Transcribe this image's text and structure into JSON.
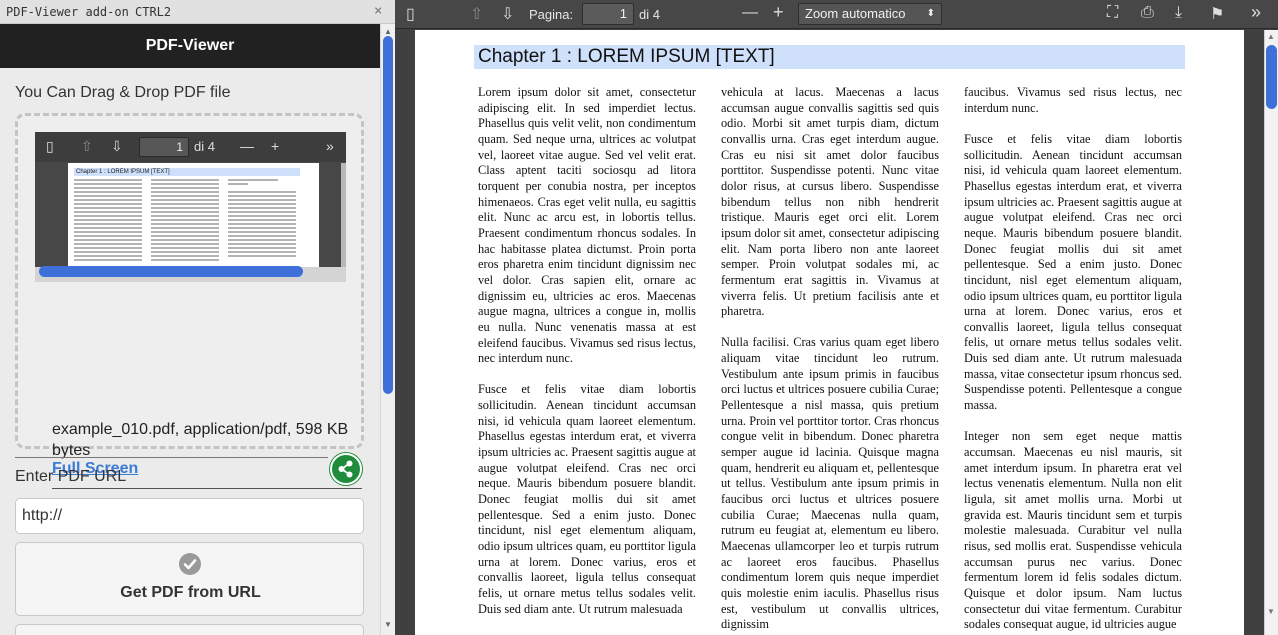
{
  "addon": {
    "window_title": "PDF-Viewer add-on",
    "shortcut": "CTRL2",
    "close_glyph": "×",
    "header": "PDF-Viewer",
    "drop_label": "You Can Drag & Drop PDF file",
    "file_info": "example_010.pdf, application/pdf, 598 KB bytes",
    "fullscreen_link": "Full Screen",
    "url_label": "Enter PDF URL",
    "url_value": "http://",
    "get_button": "Get PDF from URL",
    "share_icon": "share-icon",
    "mini_viewer": {
      "page_value": "1",
      "page_of": "di 4",
      "chapter": "Chapter 1 : LOREM IPSUM [TEXT]"
    }
  },
  "viewer": {
    "toolbar": {
      "sidebar_toggle": "▯",
      "prev": "⇧",
      "next": "⇩",
      "page_label": "Pagina:",
      "page_value": "1",
      "page_of": "di 4",
      "zoom_out": "—",
      "zoom_in": "+",
      "zoom_value": "Zoom automatico",
      "zoom_caret": "⬍",
      "fullscreen": "⛶",
      "print": "⎙",
      "download": "⤓",
      "bookmark": "⚑",
      "more": "»"
    },
    "chapter_title": "Chapter 1 : LOREM IPSUM [TEXT]",
    "columns": [
      [
        "Lorem ipsum dolor sit amet, consectetur adipiscing elit. In sed imperdiet lectus. Phasellus quis velit velit, non condimentum quam. Sed neque urna, ultrices ac volutpat vel, laoreet vitae augue. Sed vel velit erat. Class aptent taciti sociosqu ad litora torquent per conubia nostra, per inceptos himenaeos. Cras eget velit nulla, eu sagittis elit. Nunc ac arcu est, in lobortis tellus. Praesent condimentum rhoncus sodales. In hac habitasse platea dictumst. Proin porta eros pharetra enim tincidunt dignissim nec vel dolor. Cras sapien elit, ornare ac dignissim eu, ultricies ac eros. Maecenas augue magna, ultrices a congue in, mollis eu nulla. Nunc venenatis massa at est eleifend faucibus. Vivamus sed risus lectus, nec interdum nunc.",
        "Fusce et felis vitae diam lobortis sollicitudin. Aenean tincidunt accumsan nisi, id vehicula quam laoreet elementum. Phasellus egestas interdum erat, et viverra ipsum ultricies ac. Praesent sagittis augue at augue volutpat eleifend. Cras nec orci neque. Mauris bibendum posuere blandit. Donec feugiat mollis dui sit amet pellentesque. Sed a enim justo. Donec tincidunt, nisl eget elementum aliquam, odio ipsum ultrices quam, eu porttitor ligula urna at lorem. Donec varius, eros et convallis laoreet, ligula tellus consequat felis, ut ornare metus tellus sodales velit. Duis sed diam ante. Ut rutrum malesuada"
      ],
      [
        "vehicula at lacus. Maecenas a lacus accumsan augue convallis sagittis sed quis odio. Morbi sit amet turpis diam, dictum convallis urna. Cras eget interdum augue. Cras eu nisi sit amet dolor faucibus porttitor. Suspendisse potenti. Nunc vitae dolor risus, at cursus libero. Suspendisse bibendum tellus non nibh hendrerit tristique. Mauris eget orci elit. Lorem ipsum dolor sit amet, consectetur adipiscing elit. Nam porta libero non ante laoreet semper. Proin volutpat sodales mi, ac fermentum erat sagittis in. Vivamus at viverra felis. Ut pretium facilisis ante et pharetra.",
        "Nulla facilisi. Cras varius quam eget libero aliquam vitae tincidunt leo rutrum. Vestibulum ante ipsum primis in faucibus orci luctus et ultrices posuere cubilia Curae; Pellentesque a nisl massa, quis pretium urna. Proin vel porttitor tortor. Cras rhoncus congue velit in bibendum. Donec pharetra semper augue id lacinia. Quisque magna quam, hendrerit eu aliquam et, pellentesque ut tellus. Vestibulum ante ipsum primis in faucibus orci luctus et ultrices posuere cubilia Curae; Maecenas nulla quam, rutrum eu feugiat at, elementum eu libero. Maecenas ullamcorper leo et turpis rutrum ac laoreet eros faucibus. Phasellus condimentum lorem quis neque imperdiet quis molestie enim iaculis. Phasellus risus est, vestibulum ut convallis ultrices, dignissim"
      ],
      [
        "faucibus. Vivamus sed risus lectus, nec interdum nunc.",
        "Fusce et felis vitae diam lobortis sollicitudin. Aenean tincidunt accumsan nisi, id vehicula quam laoreet elementum. Phasellus egestas interdum erat, et viverra ipsum ultricies ac. Praesent sagittis augue at augue volutpat eleifend. Cras nec orci neque. Mauris bibendum posuere blandit. Donec feugiat mollis dui sit amet pellentesque. Sed a enim justo. Donec tincidunt, nisl eget elementum aliquam, odio ipsum ultrices quam, eu porttitor ligula urna at lorem. Donec varius, eros et convallis laoreet, ligula tellus consequat felis, ut ornare metus tellus sodales velit. Duis sed diam ante. Ut rutrum malesuada massa, vitae consectetur ipsum rhoncus sed. Suspendisse potenti. Pellentesque a congue massa.",
        "Integer non sem eget neque mattis accumsan. Maecenas eu nisl mauris, sit amet interdum ipsum. In pharetra erat vel lectus venenatis elementum. Nulla non elit ligula, sit amet mollis urna. Morbi ut gravida est. Mauris tincidunt sem et turpis molestie malesuada. Curabitur vel nulla risus, sed mollis erat. Suspendisse vehicula accumsan purus nec varius. Donec fermentum lorem id felis sodales dictum. Quisque et dolor ipsum. Nam luctus consectetur dui vitae fermentum. Curabitur sodales consequat augue, id ultricies augue"
      ]
    ]
  },
  "colors": {
    "accent_blue": "#3f6fd8",
    "header_bg": "#212121",
    "share_green": "#1e8c3a",
    "chapter_highlight": "#cfe0fb",
    "viewer_toolbar": "#474747"
  }
}
